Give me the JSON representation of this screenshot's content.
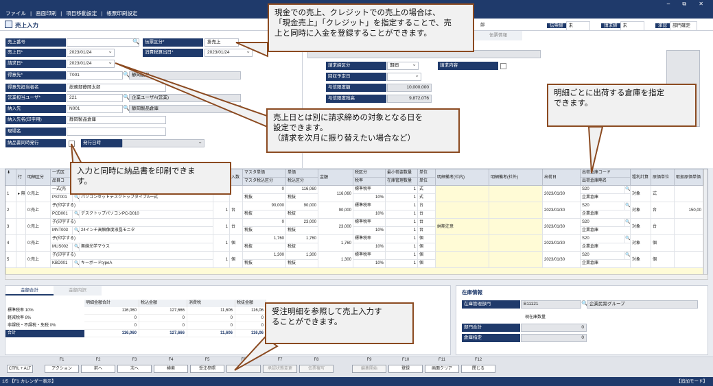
{
  "menu": [
    "ファイル",
    "|",
    "画面印刷",
    "|",
    "項目移動設定",
    "|",
    "帳票印刷設定"
  ],
  "window_buttons": "–  ⧉  ✕",
  "page": {
    "title": "売上入力"
  },
  "header_fields": [
    {
      "label": "伝票締",
      "value": "未"
    },
    {
      "label": "請求締",
      "value": "未"
    },
    {
      "label": "承認",
      "value": "部門確定"
    }
  ],
  "header_partial_text": "郎",
  "form": {
    "sales_no": {
      "label": "売上番号",
      "value": ""
    },
    "slip_type": {
      "label": "伝票区分*",
      "value": "掛売上"
    },
    "sales_date": {
      "label": "売上日*",
      "value": "2023/01/24"
    },
    "tax_date": {
      "label": "消費税算出日*",
      "value": "2023/01/24"
    },
    "billing_date": {
      "label": "請求日*",
      "value": "2023/01/24"
    },
    "customer": {
      "label": "得意先*",
      "code": "T001",
      "name": "静岡製品"
    },
    "customer_rep": {
      "label": "得意先担当者名",
      "value": "総務部静岡太郎"
    },
    "sales_rep": {
      "label": "営業担当ユーザ*",
      "code": "221",
      "name": "企業ユーザA(営業)"
    },
    "delivery": {
      "label": "納入先",
      "code": "N001",
      "name": "静岡製品倉庫"
    },
    "delivery_print": {
      "label": "納入先名(印字用)",
      "value": "静岡製品倉庫"
    },
    "site": {
      "label": "現場名",
      "value": ""
    },
    "print_delivery": {
      "label": "納品書同時発行",
      "issue_label": "発行日時",
      "issue_value": ""
    }
  },
  "right_panel": {
    "tab": "伝票情報",
    "billing_type": {
      "label": "請求締区分",
      "value": "期間"
    },
    "billing_content": {
      "label": "請求内容",
      "value": ""
    },
    "collection_date": {
      "label": "回収予定日",
      "value": ""
    },
    "credit_limit": {
      "label": "与信限度額",
      "value": "10,000,000"
    },
    "credit_balance": {
      "label": "与信限度残高",
      "value": "9,872,076"
    }
  },
  "grid": {
    "headers_top": [
      "行",
      "明細区分",
      "一式区",
      "品目コ",
      "数",
      "入数",
      "マスタ単価",
      "単価",
      "金額",
      "税区分",
      "最小荷姿数量",
      "単位",
      "明細備考(社内)",
      "明細備考(社外)",
      "出荷日",
      "出荷倉庫コード",
      "粗利計算",
      "原価単位",
      "取扱原価単価"
    ],
    "headers_bottom": [
      "マスタ税込区分",
      "税込区分",
      "税率",
      "在庫管理数量",
      "単位",
      "出荷倉庫略名"
    ],
    "rows": [
      {
        "no": "1",
        "mark": "▸ 無",
        "type": "0:売上",
        "set_label": "一式(売",
        "item_code": "PST001",
        "item_name": "パソコンセットデスクトップタイプA一式",
        "qty": "",
        "entry": "",
        "master_price": "0",
        "tax_in": "税抜",
        "price": "116,060",
        "amount": "116,060",
        "tax_class": "標準税率",
        "rate": "10%",
        "min_qty": "1",
        "unit": "式",
        "stock_qty": "1",
        "stock_unit": "式",
        "note_in": "",
        "ship_date": "2023/01/30",
        "wh_code": "S20",
        "wh_name": "企業倉庫",
        "gross": "対象",
        "cost_unit": "式",
        "cost": ""
      },
      {
        "no": "2",
        "mark": "",
        "type": "0:売上",
        "set_label": "子(印字する)",
        "item_code": "PCD001",
        "item_name": "デスクトップパソコンPC-D010",
        "qty": "1",
        "entry": "台",
        "master_price": "90,000",
        "tax_in": "税抜",
        "price": "90,000",
        "amount": "90,000",
        "tax_class": "標準税率",
        "rate": "10%",
        "min_qty": "1",
        "unit": "台",
        "stock_qty": "1",
        "stock_unit": "台",
        "note_in": "",
        "ship_date": "2023/01/30",
        "wh_code": "S20",
        "wh_name": "企業倉庫",
        "gross": "対象",
        "cost_unit": "台",
        "cost": "150,00"
      },
      {
        "no": "3",
        "mark": "",
        "type": "0:売上",
        "set_label": "子(印字する)",
        "item_code": "MNT003",
        "item_name": "24インチ高解像度液晶モニタ",
        "qty": "1",
        "entry": "台",
        "master_price": "0",
        "tax_in": "税抜",
        "price": "23,000",
        "amount": "23,000",
        "tax_class": "標準税率",
        "rate": "10%",
        "min_qty": "1",
        "unit": "台",
        "stock_qty": "1",
        "stock_unit": "台",
        "note_in": "納期注意",
        "ship_date": "2023/01/30",
        "wh_code": "S20",
        "wh_name": "企業倉庫",
        "gross": "対象",
        "cost_unit": "台",
        "cost": ""
      },
      {
        "no": "4",
        "mark": "",
        "type": "0:売上",
        "set_label": "子(印字する)",
        "item_code": "MUS002",
        "item_name": "無線光学マウス",
        "qty": "1",
        "entry": "個",
        "master_price": "1,760",
        "tax_in": "税抜",
        "price": "1,760",
        "amount": "1,760",
        "tax_class": "標準税率",
        "rate": "10%",
        "min_qty": "1",
        "unit": "個",
        "stock_qty": "1",
        "stock_unit": "個",
        "note_in": "",
        "ship_date": "2023/01/30",
        "wh_code": "S20",
        "wh_name": "企業倉庫",
        "gross": "対象",
        "cost_unit": "個",
        "cost": ""
      },
      {
        "no": "5",
        "mark": "",
        "type": "0:売上",
        "set_label": "子(印字する)",
        "item_code": "KBD001",
        "item_name": "キーボードtypeA",
        "qty": "1",
        "entry": "個",
        "master_price": "1,300",
        "tax_in": "税抜",
        "price": "1,300",
        "amount": "1,300",
        "tax_class": "標準税率",
        "rate": "10%",
        "min_qty": "1",
        "unit": "個",
        "stock_qty": "1",
        "stock_unit": "個",
        "note_in": "",
        "ship_date": "2023/01/30",
        "wh_code": "S20",
        "wh_name": "企業倉庫",
        "gross": "対象",
        "cost_unit": "個",
        "cost": ""
      }
    ]
  },
  "totals": {
    "tabs": [
      "金額合計",
      "金額内訳"
    ],
    "columns": [
      "明細金額合計",
      "税込金額",
      "消費税",
      "税抜金額"
    ],
    "rows": [
      {
        "label": "標準税率  10%",
        "values": [
          "116,060",
          "127,666",
          "11,606",
          "116,06"
        ]
      },
      {
        "label": "軽減税率  8%",
        "values": [
          "0",
          "0",
          "0",
          "0"
        ]
      },
      {
        "label": "非課税・不課税・免税  0%",
        "values": [
          "0",
          "0",
          "0",
          "0"
        ]
      },
      {
        "label": "合計",
        "values": [
          "116,060",
          "127,666",
          "11,606",
          "116,06"
        ]
      }
    ]
  },
  "stock": {
    "title": "在庫情報",
    "dept_label": "在庫管理部門",
    "dept_code": "B11121",
    "dept_name": "企業民需グループ",
    "current_label": "現在庫数量",
    "dept_total_label": "部門合計",
    "dept_total": "0",
    "wh_label": "倉庫指定",
    "wh_value": "0"
  },
  "fkeys": [
    {
      "key": "",
      "label": "CTRL + ALT",
      "enabled": true
    },
    {
      "key": "F1",
      "label": "アクション",
      "enabled": true
    },
    {
      "key": "F2",
      "label": "前へ",
      "enabled": true
    },
    {
      "key": "F3",
      "label": "次へ",
      "enabled": true
    },
    {
      "key": "F4",
      "label": "検索",
      "enabled": true
    },
    {
      "key": "F5",
      "label": "受注参照",
      "enabled": true
    },
    {
      "key": "F6",
      "label": "",
      "enabled": false
    },
    {
      "key": "F7",
      "label": "承認状態変更",
      "enabled": false
    },
    {
      "key": "F8",
      "label": "伝票複写",
      "enabled": false
    },
    {
      "key": "F9",
      "label": "編集開始",
      "enabled": false
    },
    {
      "key": "F10",
      "label": "登録",
      "enabled": true
    },
    {
      "key": "F11",
      "label": "画面クリア",
      "enabled": true
    },
    {
      "key": "F12",
      "label": "閉じる",
      "enabled": true
    }
  ],
  "status": {
    "left": "1/5  【F1 カレンダー表示】",
    "right": "【追加モード】"
  },
  "callouts": [
    {
      "id": "cash",
      "text": "現金での売上、クレジットでの売上の場合は、\n「現金売上」「クレジット」を指定することで、売\n上と同時に入金を登録することができます。"
    },
    {
      "id": "warehouse",
      "text": "明細ごとに出荷する倉庫を指定\nできます。"
    },
    {
      "id": "billing",
      "text": "売上日とは別に請求締めの対象となる日を\n設定できます。\n（請求を次月に振り替えたい場合など）"
    },
    {
      "id": "print",
      "text": "入力と同時に納品書を印刷できま\nす。"
    },
    {
      "id": "order",
      "text": "受注明細を参照して売上入力す\nることができます。"
    }
  ],
  "colors": {
    "navy": "#1f3a6b",
    "callout_border": "#8b4a20"
  }
}
